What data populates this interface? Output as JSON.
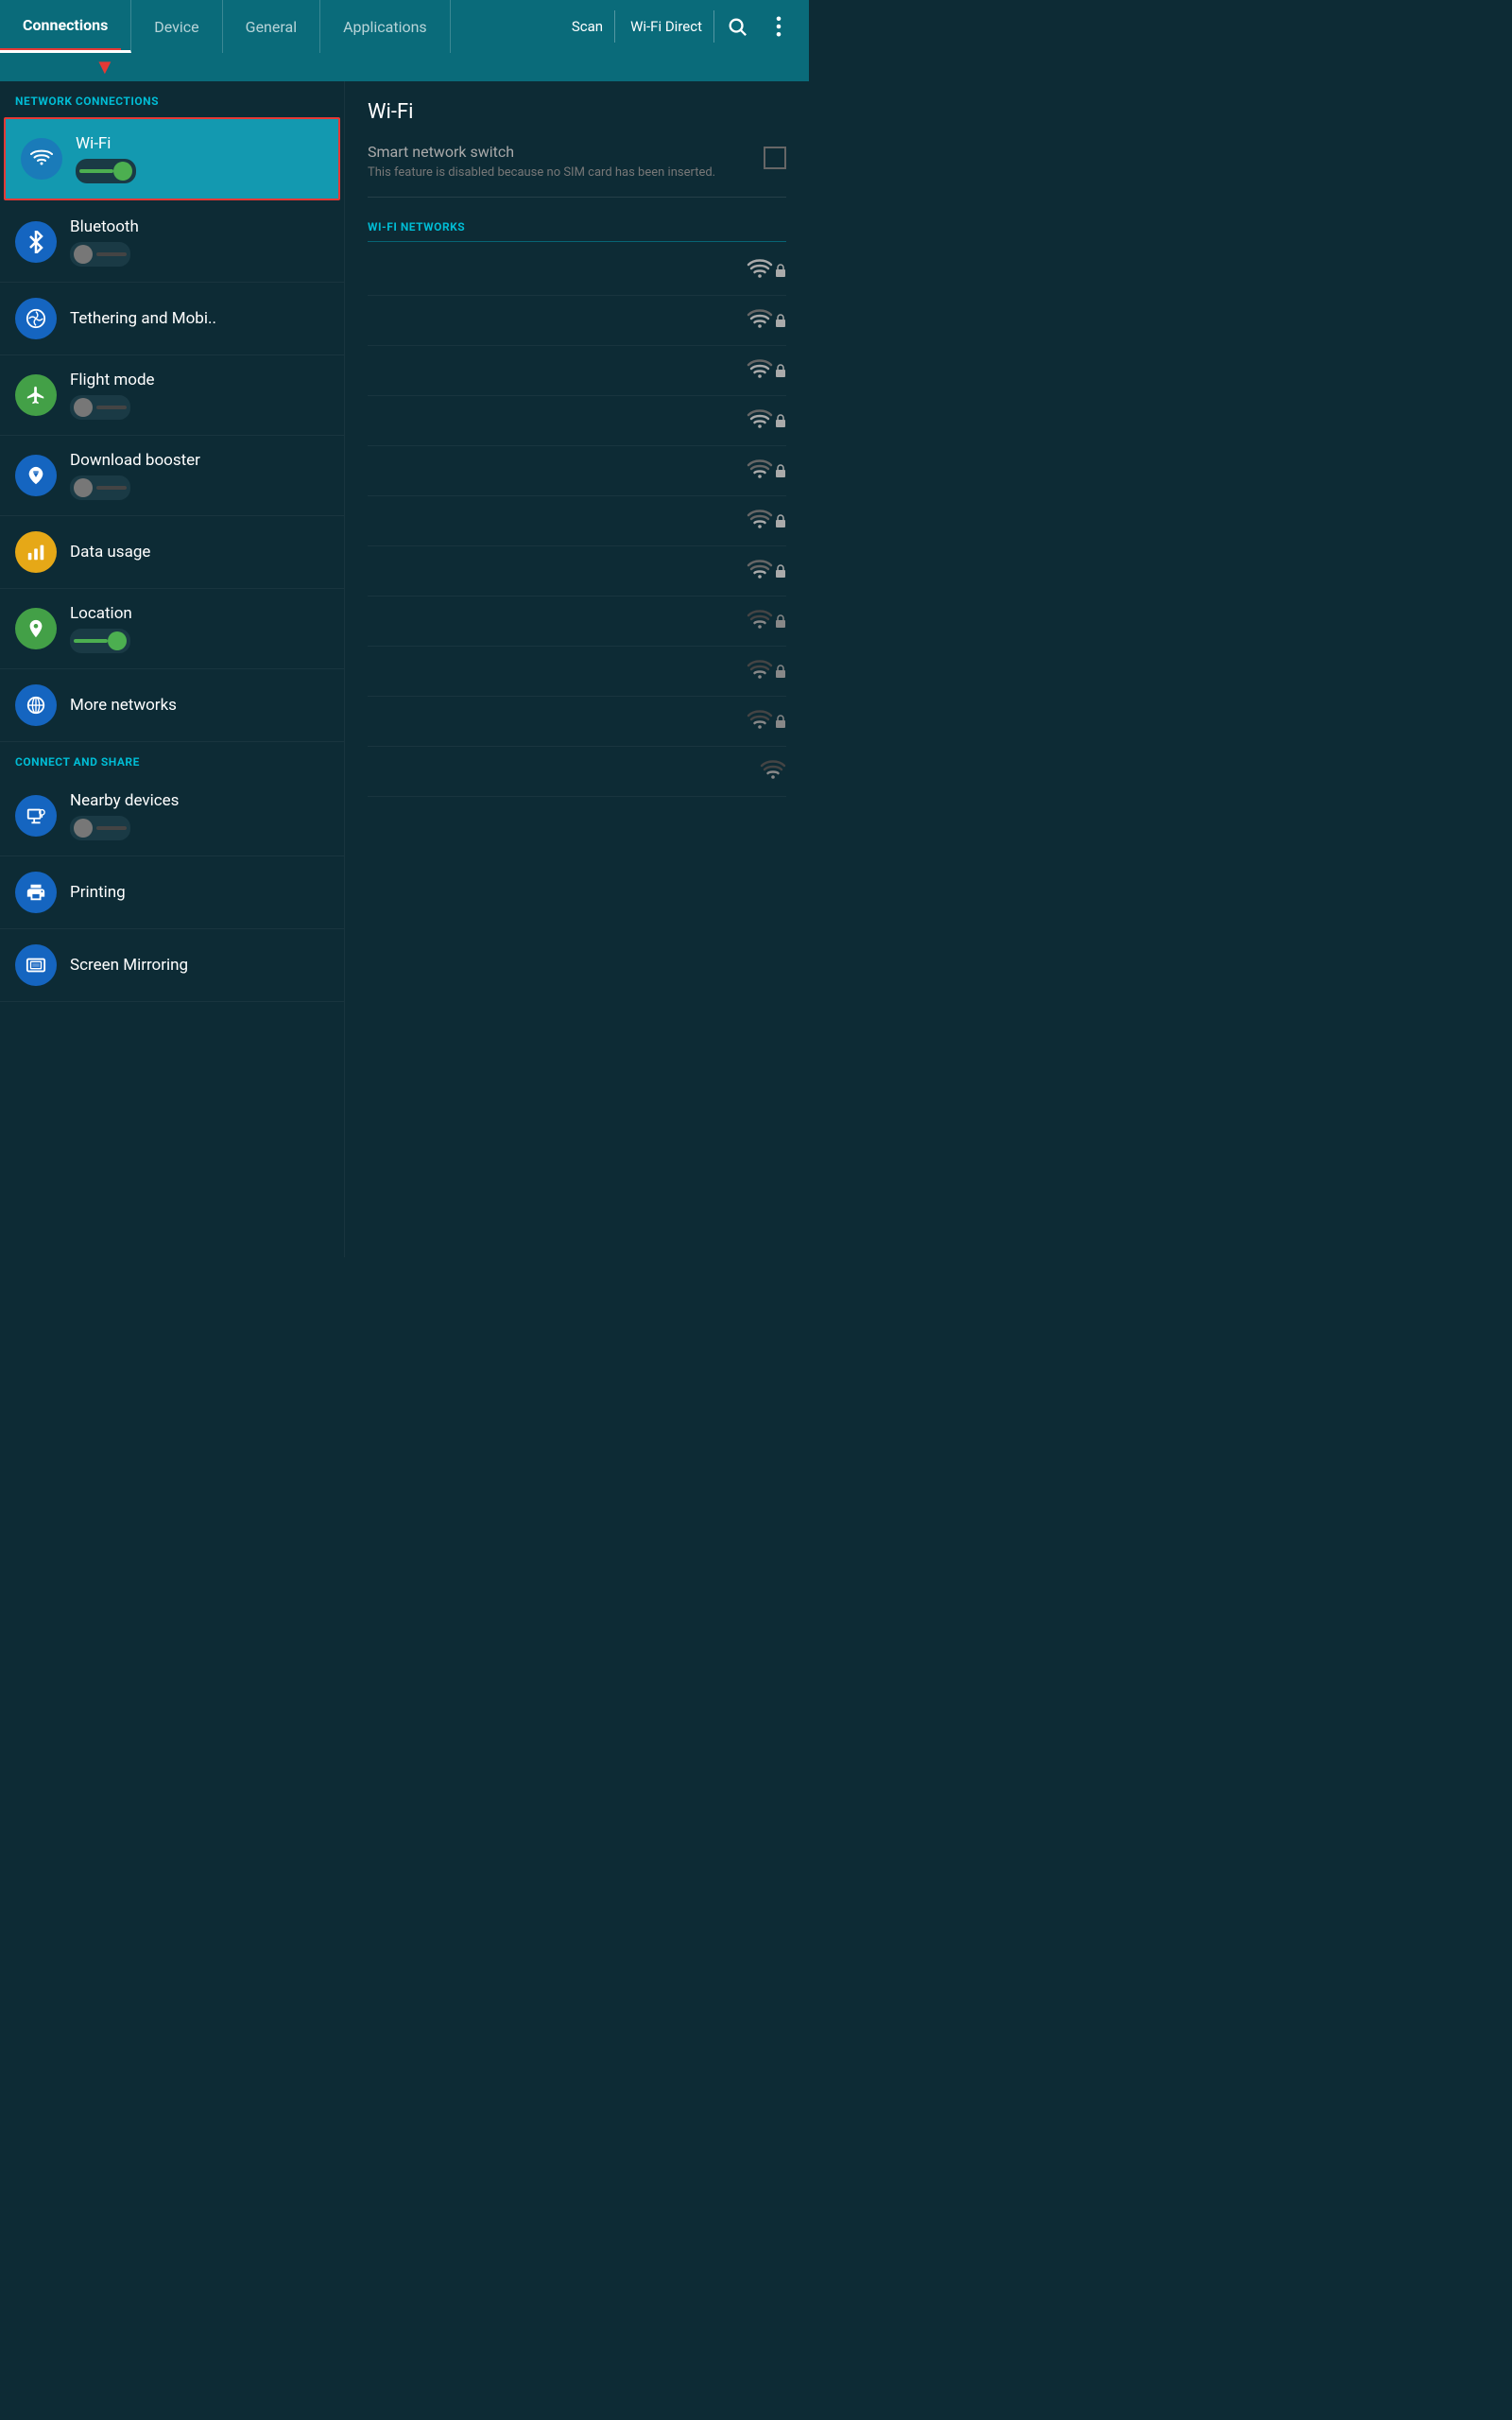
{
  "tabs": [
    {
      "id": "connections",
      "label": "Connections",
      "active": true
    },
    {
      "id": "device",
      "label": "Device",
      "active": false
    },
    {
      "id": "general",
      "label": "General",
      "active": false
    },
    {
      "id": "applications",
      "label": "Applications",
      "active": false
    }
  ],
  "header": {
    "scan_label": "Scan",
    "wifi_direct_label": "Wi-Fi Direct"
  },
  "sidebar": {
    "network_connections_label": "NETWORK CONNECTIONS",
    "connect_share_label": "CONNECT AND SHARE",
    "items": [
      {
        "id": "wifi",
        "label": "Wi-Fi",
        "toggle": "on",
        "icon": "wifi",
        "active": true
      },
      {
        "id": "bluetooth",
        "label": "Bluetooth",
        "toggle": "off",
        "icon": "bluetooth"
      },
      {
        "id": "tethering",
        "label": "Tethering and Mobi..",
        "icon": "tethering"
      },
      {
        "id": "flight",
        "label": "Flight mode",
        "toggle": "off",
        "icon": "flight"
      },
      {
        "id": "download",
        "label": "Download booster",
        "toggle": "off",
        "icon": "download"
      },
      {
        "id": "data",
        "label": "Data usage",
        "icon": "data"
      },
      {
        "id": "location",
        "label": "Location",
        "toggle": "on",
        "icon": "location"
      },
      {
        "id": "networks",
        "label": "More networks",
        "icon": "networks"
      }
    ],
    "share_items": [
      {
        "id": "nearby",
        "label": "Nearby devices",
        "toggle": "off",
        "icon": "nearby"
      },
      {
        "id": "printing",
        "label": "Printing",
        "icon": "printing"
      },
      {
        "id": "mirroring",
        "label": "Screen Mirroring",
        "icon": "mirroring"
      }
    ]
  },
  "content": {
    "title": "Wi-Fi",
    "smart_switch": {
      "label": "Smart network switch",
      "description": "This feature is disabled because no SIM card has been inserted."
    },
    "networks_label": "WI-FI NETWORKS",
    "networks": [
      {
        "name": "",
        "locked": true,
        "strength": 4
      },
      {
        "name": "",
        "locked": true,
        "strength": 3
      },
      {
        "name": "",
        "locked": true,
        "strength": 3
      },
      {
        "name": "",
        "locked": true,
        "strength": 3
      },
      {
        "name": "",
        "locked": true,
        "strength": 3
      },
      {
        "name": "",
        "locked": true,
        "strength": 3
      },
      {
        "name": "",
        "locked": true,
        "strength": 3
      },
      {
        "name": "",
        "locked": true,
        "strength": 2
      },
      {
        "name": "",
        "locked": true,
        "strength": 2
      },
      {
        "name": "",
        "locked": true,
        "strength": 2
      },
      {
        "name": "",
        "locked": false,
        "strength": 2
      }
    ]
  }
}
